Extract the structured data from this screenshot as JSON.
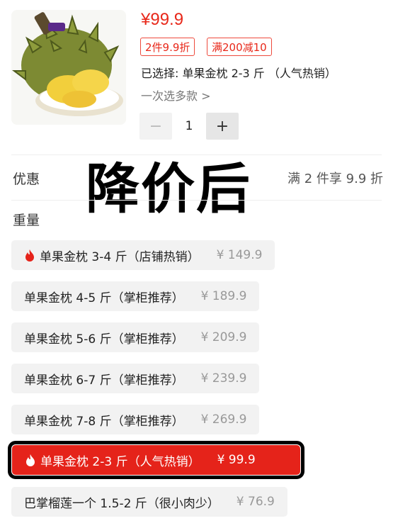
{
  "product": {
    "price": "¥99.9",
    "badges": [
      "2件9.9折",
      "满200减10"
    ],
    "selected_label": "已选择: 单果金枕 2-3 斤 （人气热销）",
    "multi_select": "一次选多款 >",
    "quantity": "1"
  },
  "overlay_text": "降价后",
  "promo": {
    "label": "优惠",
    "value": "满 2 件享 9.9 折"
  },
  "weight": {
    "label": "重量",
    "options": [
      {
        "name": "单果金枕 3-4 斤（店铺热销）",
        "price": "¥ 149.9",
        "hot": true,
        "active": false
      },
      {
        "name": "单果金枕 4-5 斤（掌柜推荐）",
        "price": "¥ 189.9",
        "hot": false,
        "active": false
      },
      {
        "name": "单果金枕 5-6 斤（掌柜推荐）",
        "price": "¥ 209.9",
        "hot": false,
        "active": false
      },
      {
        "name": "单果金枕 6-7 斤（掌柜推荐）",
        "price": "¥ 239.9",
        "hot": false,
        "active": false
      },
      {
        "name": "单果金枕 7-8 斤（掌柜推荐）",
        "price": "¥ 269.9",
        "hot": false,
        "active": false
      },
      {
        "name": "单果金枕 2-3 斤（人气热销）",
        "price": "¥ 99.9",
        "hot": true,
        "active": true
      },
      {
        "name": "巴掌榴莲一个 1.5-2 斤（很小肉少）",
        "price": "¥ 76.9",
        "hot": false,
        "active": false
      }
    ]
  },
  "colors": {
    "accent": "#e5231a",
    "badge_border": "#ee4a3c",
    "option_bg": "#f2f2f2"
  },
  "icons": {
    "hot": "fire-icon",
    "stepper_minus": "minus-icon",
    "stepper_plus": "plus-icon"
  }
}
